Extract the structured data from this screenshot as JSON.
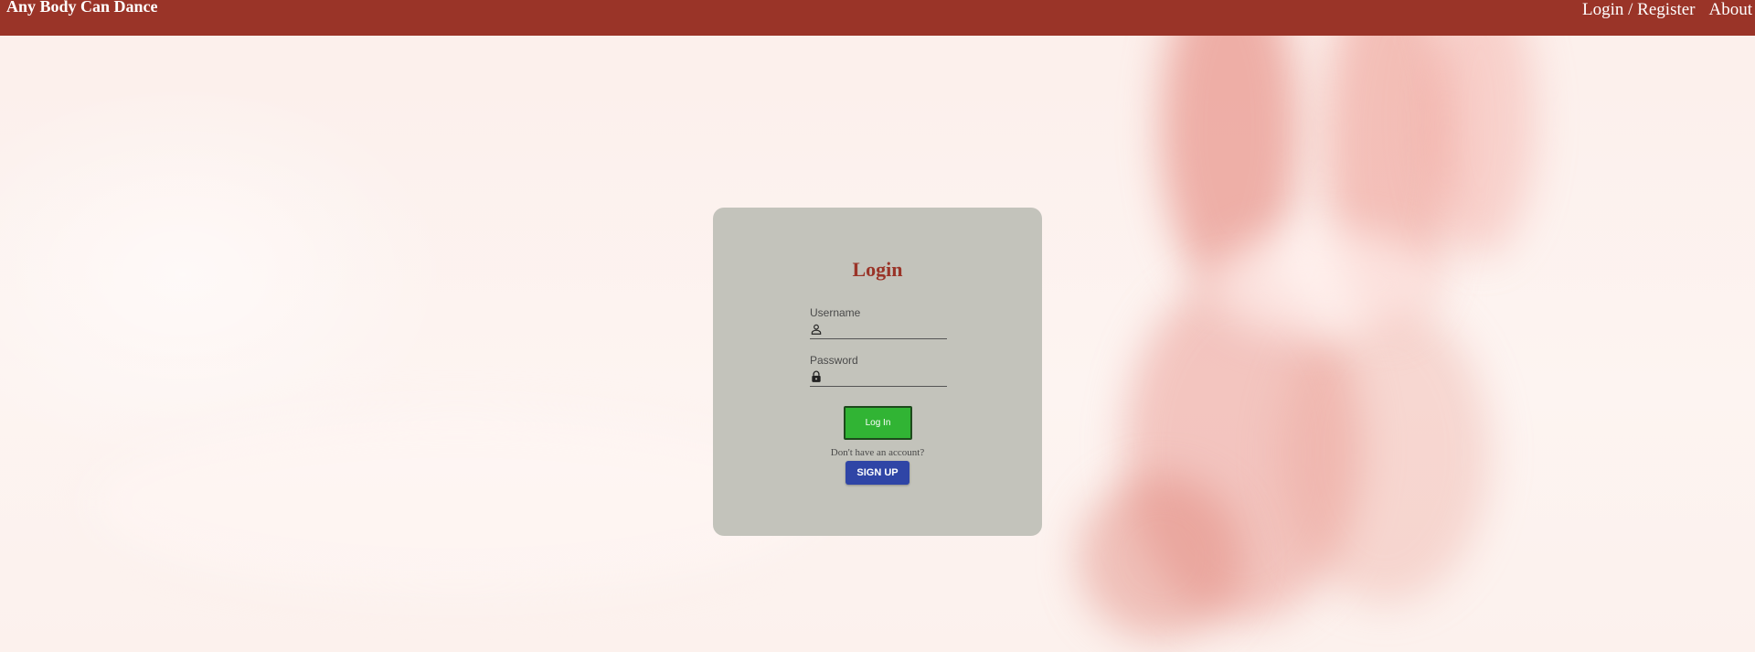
{
  "navbar": {
    "brand": "Any Body Can Dance",
    "links": [
      {
        "label": "Login / Register"
      },
      {
        "label": "About"
      }
    ],
    "color": "#9a3428"
  },
  "login_card": {
    "title": "Login",
    "username": {
      "label": "Username",
      "value": "",
      "icon": "person-icon"
    },
    "password": {
      "label": "Password",
      "value": "",
      "icon": "lock-icon"
    },
    "login_button": "Log In",
    "no_account_text": "Don't have an account?",
    "signup_button": "SIGN UP"
  },
  "colors": {
    "card_bg": "#c3c3bb",
    "login_button": "#31b434",
    "signup_button": "#2f45a6",
    "title": "#9a3428"
  }
}
